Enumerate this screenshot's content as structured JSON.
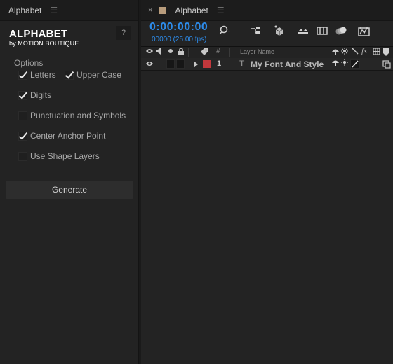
{
  "left_panel": {
    "tab_title": "Alphabet",
    "menu_icon": "☰",
    "logo_title": "ALPHABET",
    "logo_subtitle": "by MOTION BOUTIQUE",
    "help_label": "?",
    "options_label": "Options",
    "options": {
      "letters": {
        "label": "Letters",
        "checked": true
      },
      "upper_case": {
        "label": "Upper Case",
        "checked": true
      },
      "digits": {
        "label": "Digits",
        "checked": true
      },
      "punctuation": {
        "label": "Punctuation and Symbols",
        "checked": false
      },
      "center_anchor": {
        "label": "Center Anchor Point",
        "checked": true
      },
      "shape_layers": {
        "label": "Use Shape Layers",
        "checked": false
      }
    },
    "generate_label": "Generate"
  },
  "comp_panel": {
    "close_icon": "×",
    "tab_title": "Alphabet",
    "menu_icon": "☰",
    "swatch_color": "#b89c7c",
    "timecode": "0:00:00:00",
    "frames": "00000 (25.00 fps)",
    "accent_color": "#2d8ceb",
    "toolbar_icons": [
      "search-icon",
      "composition-flowchart-icon",
      "draft-3d-icon",
      "shy-layers-icon",
      "frame-blending-icon",
      "motion-blur-icon",
      "graph-editor-icon"
    ],
    "layer_header": {
      "layer_name_label": "Layer Name",
      "number_label": "#",
      "fx_label": "fx"
    },
    "layers": [
      {
        "number": "1",
        "type_glyph": "T",
        "name": "My Font And Style",
        "label_color": "#c3383c"
      }
    ]
  }
}
